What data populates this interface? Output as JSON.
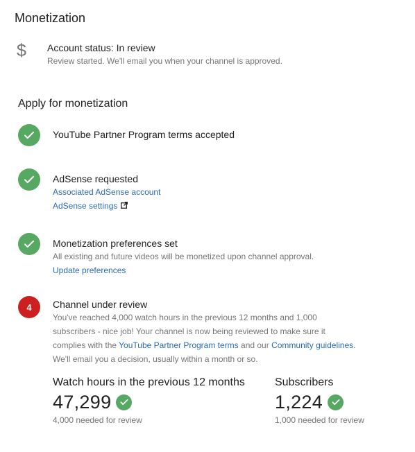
{
  "page": {
    "title": "Monetization"
  },
  "account_status": {
    "icon": "dollar-icon",
    "title": "Account status: In review",
    "subtitle": "Review started. We'll email you when your channel is approved."
  },
  "apply": {
    "title": "Apply for monetization",
    "steps": [
      {
        "state": "done",
        "title": "YouTube Partner Program terms accepted"
      },
      {
        "state": "done",
        "title": "AdSense requested",
        "links": [
          "Associated AdSense account",
          "AdSense settings"
        ]
      },
      {
        "state": "done",
        "title": "Monetization preferences set",
        "description": "All existing and future videos will be monetized upon channel approval.",
        "links": [
          "Update preferences"
        ]
      },
      {
        "state": "pending",
        "number": "4",
        "title": "Channel under review",
        "description_lines": [
          "You've reached 4,000 watch hours in the previous 12 months and 1,000",
          "subscribers - nice job! Your channel is now being reviewed to make sure it",
          "complies with the ",
          "YouTube Partner Program terms",
          " and our ",
          "Community guidelines",
          ".",
          "We'll email you a decision, usually within a month or so."
        ]
      }
    ]
  },
  "metrics": {
    "watch_hours": {
      "label": "Watch hours in the previous 12 months",
      "value": "47,299",
      "needed": "4,000 needed for review"
    },
    "subscribers": {
      "label": "Subscribers",
      "value": "1,224",
      "needed": "1,000 needed for review"
    }
  },
  "colors": {
    "check_green": "#57a863",
    "step_red": "#cc1f1f",
    "link_blue": "#2a6bb5"
  }
}
